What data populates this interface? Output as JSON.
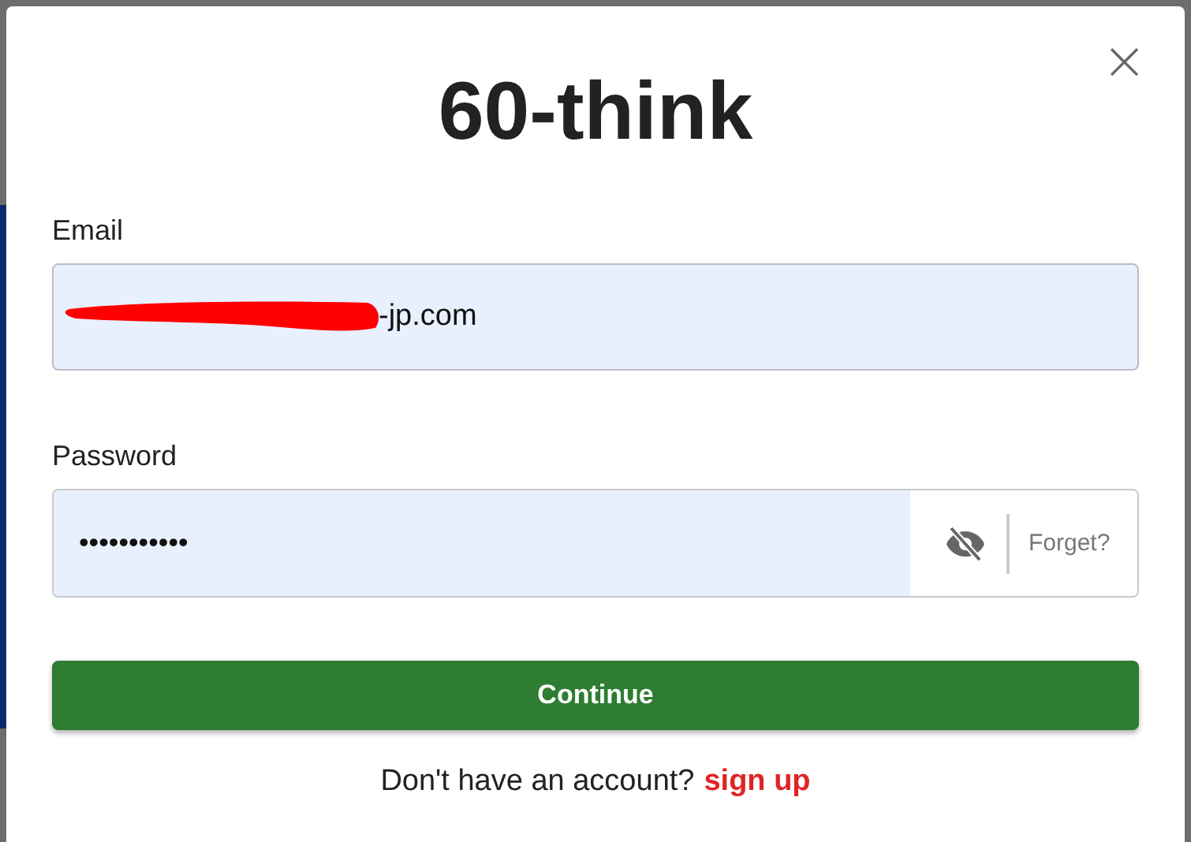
{
  "dialog": {
    "title": "60-think",
    "close": "×"
  },
  "email": {
    "label": "Email",
    "value": "-jp.com",
    "redacted": true
  },
  "password": {
    "label": "Password",
    "value": "•••••••••••",
    "visible": false,
    "forgot_link": "Forget?"
  },
  "continue_button": "Continue",
  "signup": {
    "prompt": "Don't have an account?",
    "link": "sign up"
  }
}
